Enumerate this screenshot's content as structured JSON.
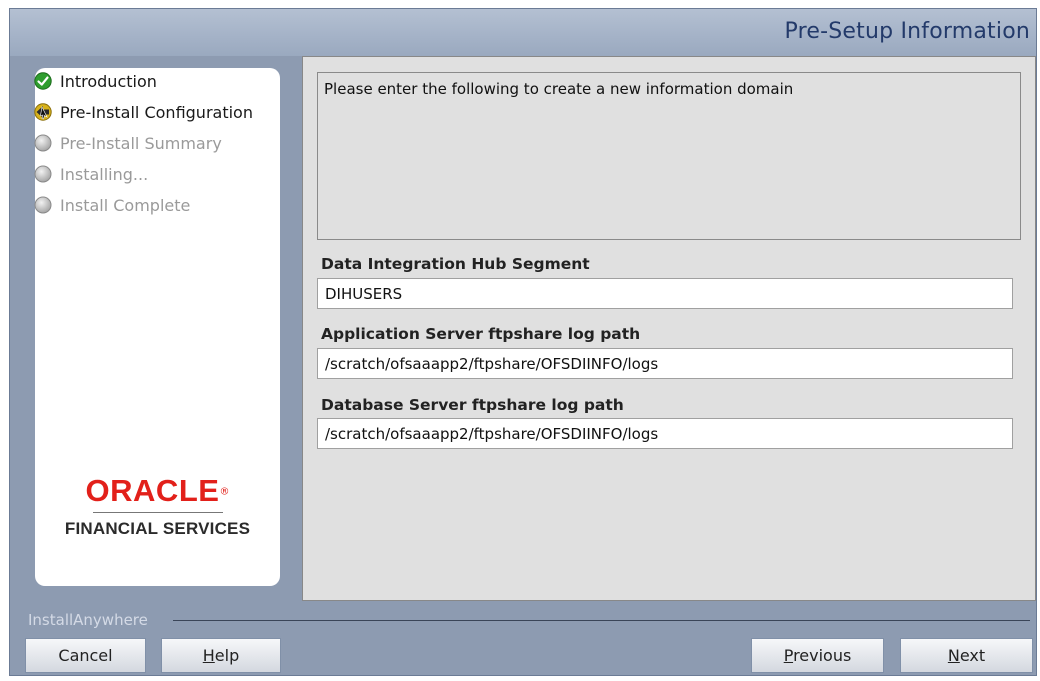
{
  "header": {
    "title": "Pre-Setup Information"
  },
  "steps": [
    {
      "label": "Introduction",
      "state": "done"
    },
    {
      "label": "Pre-Install Configuration",
      "state": "current"
    },
    {
      "label": "Pre-Install Summary",
      "state": "pending"
    },
    {
      "label": "Installing...",
      "state": "pending"
    },
    {
      "label": "Install Complete",
      "state": "pending"
    }
  ],
  "branding": {
    "logo_text": "ORACLE",
    "logo_trademark": "®",
    "logo_subtitle": "FINANCIAL SERVICES",
    "installer_name": "InstallAnywhere"
  },
  "content": {
    "description": "Please enter the following to create a new information domain",
    "fields": [
      {
        "label": "Data Integration Hub Segment",
        "value": "DIHUSERS"
      },
      {
        "label": "Application Server ftpshare log path",
        "value": "/scratch/ofsaaapp2/ftpshare/OFSDIINFO/logs"
      },
      {
        "label": "Database Server ftpshare log path",
        "value": "/scratch/ofsaaapp2/ftpshare/OFSDIINFO/logs"
      }
    ]
  },
  "buttons": {
    "cancel": "Cancel",
    "help": "Help",
    "previous": "Previous",
    "next": "Next"
  },
  "colors": {
    "frame_bg": "#8d9bb1",
    "header_text": "#233a6a",
    "oracle_red": "#e2201a",
    "step_done": "#2e9d2e",
    "step_current": "#d7b21c"
  }
}
